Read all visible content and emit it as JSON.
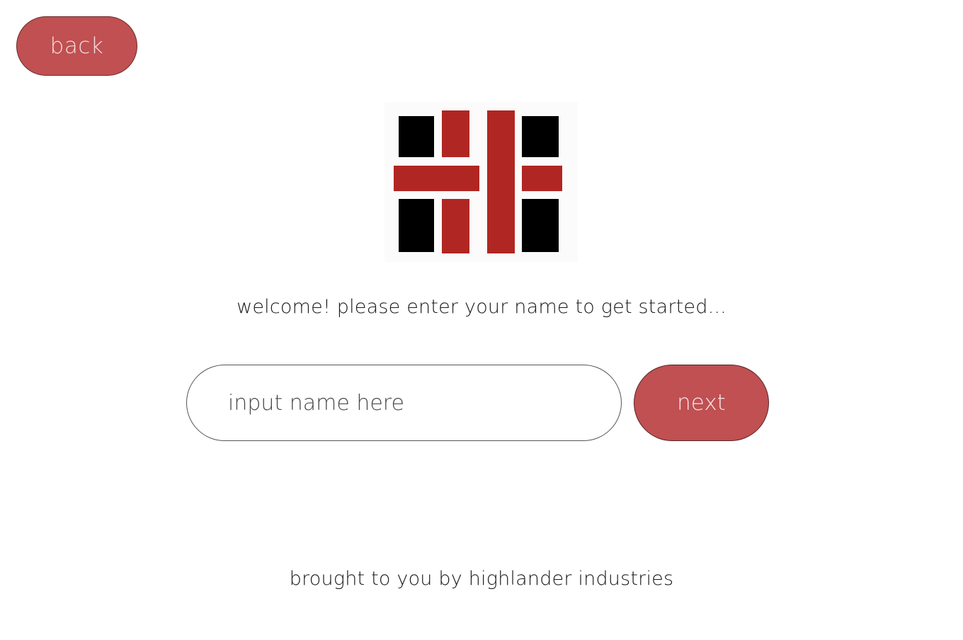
{
  "back_button": {
    "label": "back"
  },
  "welcome_text": "welcome! please enter your name to get started...",
  "name_input": {
    "value": "",
    "placeholder": "input name here"
  },
  "next_button": {
    "label": "next"
  },
  "footer_text": "brought to you by highlander industries",
  "colors": {
    "button_bg": "#c05052",
    "logo_red": "#b02622",
    "logo_black": "#000000"
  },
  "logo": {
    "icon": "highlander-industries-logo"
  }
}
